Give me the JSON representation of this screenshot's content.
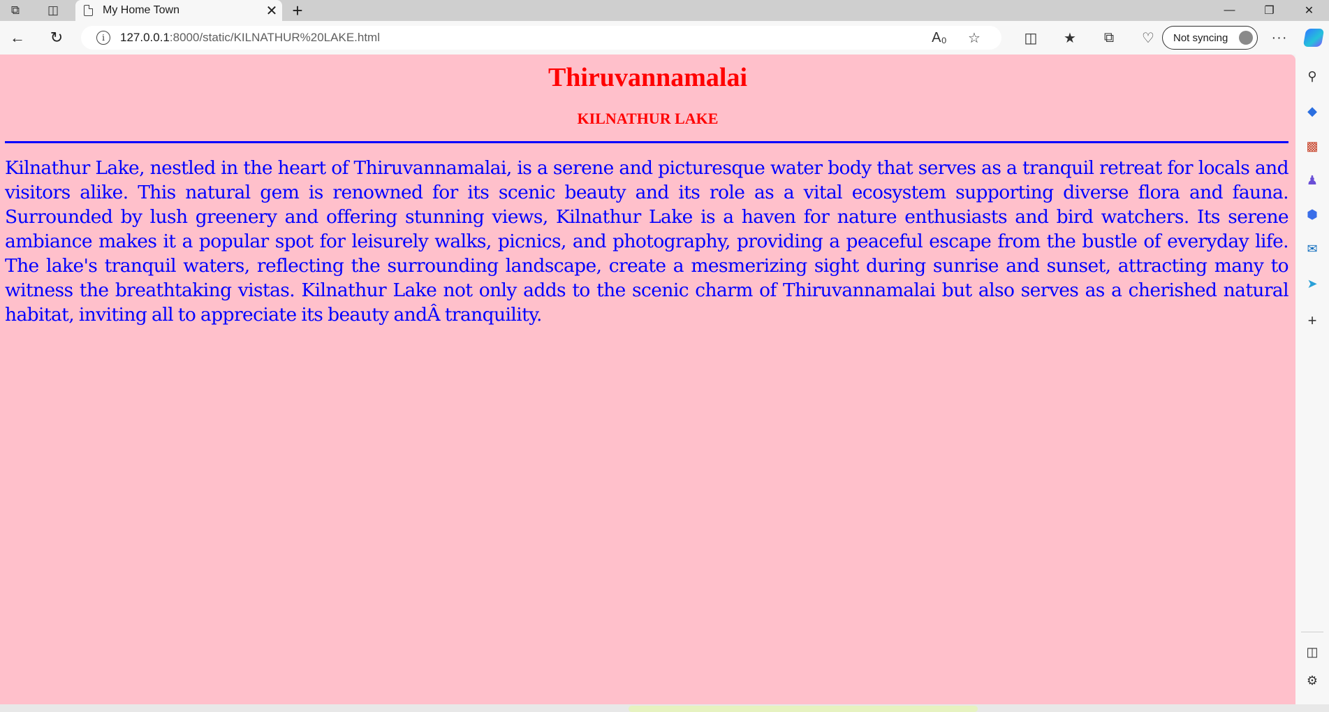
{
  "browser": {
    "tab": {
      "title": "My Home Town"
    },
    "address": {
      "host": "127.0.0.1",
      "path": ":8000/static/KILNATHUR%20LAKE.html"
    },
    "profile_button_label": "Not syncing",
    "icons": {
      "workspaces": "workspaces-icon",
      "tab_actions": "tab-actions-icon",
      "new_tab": "plus-icon",
      "back": "back-arrow-icon",
      "refresh": "refresh-icon",
      "site_info": "info-icon",
      "read_aloud": "read-aloud-icon",
      "favorite": "star-icon",
      "split_screen": "split-screen-icon",
      "favorites": "favorites-icon",
      "collections": "collections-icon",
      "browser_essentials": "heart-pulse-icon",
      "more": "ellipsis-icon",
      "copilot": "copilot-icon"
    },
    "sidebar": [
      "search-icon",
      "shopping-tag-icon",
      "toolbox-icon",
      "games-icon",
      "microsoft365-icon",
      "outlook-icon",
      "drop-icon",
      "plus-icon",
      "sidebar-toggle-icon",
      "settings-icon"
    ]
  },
  "page": {
    "background": "#ffc0cb",
    "heading": "Thiruvannamalai",
    "subheading": "KILNATHUR LAKE",
    "heading_color": "#ff0000",
    "rule_color": "#0000ff",
    "text_color": "#0000ff",
    "paragraph": "Kilnathur Lake, nestled in the heart of Thiruvannamalai, is a serene and picturesque water body that serves as a tranquil retreat for locals and visitors alike. This natural gem is renowned for its scenic beauty and its role as a vital ecosystem supporting diverse flora and fauna. Surrounded by lush greenery and offering stunning views, Kilnathur Lake is a haven for nature enthusiasts and bird watchers. Its serene ambiance makes it a popular spot for leisurely walks, picnics, and photography, providing a peaceful escape from the bustle of everyday life. The lake's tranquil waters, reflecting the surrounding landscape, create a mesmerizing sight during sunrise and sunset, attracting many to witness the breathtaking vistas. Kilnathur Lake not only adds to the scenic charm of Thiruvannamalai but also serves as a cherished natural habitat, inviting all to appreciate its beauty andÂ tranquility."
  }
}
